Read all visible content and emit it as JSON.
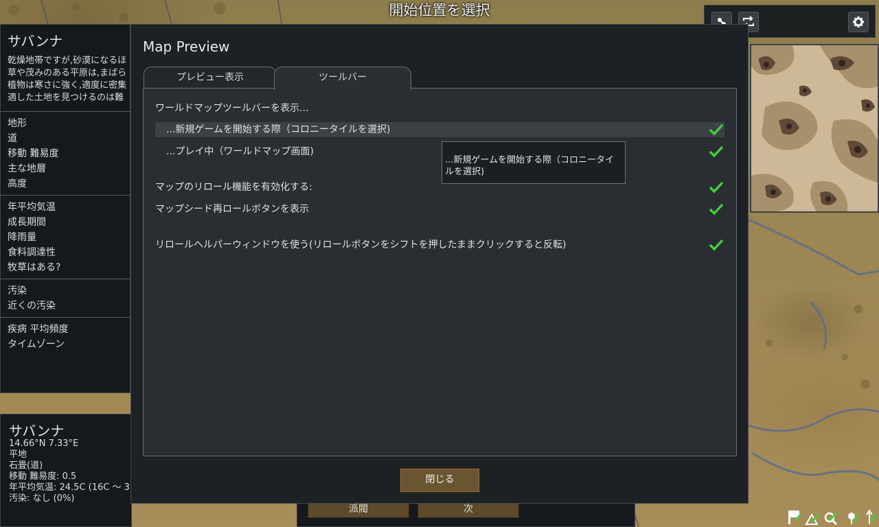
{
  "screen": {
    "title": "開始位置を選択"
  },
  "top_toolbar": {
    "buttons": [
      {
        "icon": "layers-icon"
      },
      {
        "icon": "refresh-icon"
      },
      {
        "icon": "gear-icon"
      }
    ]
  },
  "left_panel": {
    "biome_title": "サバンナ",
    "description": [
      "乾燥地帯ですが,砂漠になるほ",
      "草や茂みのある平原は,まばら",
      "植物は寒さに強く,適度に密集",
      "適した土地を見つけるのは難"
    ],
    "groups": [
      [
        "地形",
        "道",
        "移動 難易度",
        "主な地層",
        "高度"
      ],
      [
        "年平均気温",
        "成長期間",
        "降雨量",
        "食料調達性",
        "牧草はある?"
      ],
      [
        "汚染",
        "近くの汚染"
      ],
      [
        "疾病 平均頻度",
        "タイムゾーン"
      ]
    ]
  },
  "inspect_panel": {
    "title": "サバンナ",
    "lines": [
      "14.66°N 7.33°E",
      "平地",
      "石畳(道)",
      "移動 難易度: 0.5",
      "年平均気温: 24.5C (16C ～ 3",
      "汚染: なし (0%)"
    ]
  },
  "bottom_nav": {
    "back_label": "派閥",
    "next_label": "次"
  },
  "dialog": {
    "title": "Map Preview",
    "tabs": [
      {
        "label": "プレビュー表示",
        "active": false
      },
      {
        "label": "ツールバー",
        "active": true
      }
    ],
    "heading": "ワールドマップツールバーを表示...",
    "options": [
      {
        "label": "...新規ゲームを開始する際（コロニータイルを選択)",
        "checked": true,
        "highlighted": true
      },
      {
        "label": "...プレイ中（ワールドマップ画面)",
        "checked": true,
        "highlighted": false
      },
      {
        "label": "マップのリロール機能を有効化する:",
        "checked": true,
        "highlighted": false
      },
      {
        "label": "マップシード再ロールボタンを表示",
        "checked": true,
        "highlighted": false
      },
      {
        "label": "リロールヘルパーウィンドウを使う(リロールボタンをシフトを押したままクリックすると反転)",
        "checked": true,
        "highlighted": false
      }
    ],
    "tooltip": "...新規ゲームを開始する際（コロニータイルを選択)",
    "close_label": "閉じる"
  },
  "bottom_right_icons": [
    "flag-icon",
    "mountain-icon",
    "magnifier-icon",
    "pin-icon",
    "compass-icon"
  ],
  "colors": {
    "check_green": "#3fd13a",
    "button_brown": "#6b5530",
    "panel_bg": "#15191d",
    "dialog_bg": "#1d2024"
  }
}
